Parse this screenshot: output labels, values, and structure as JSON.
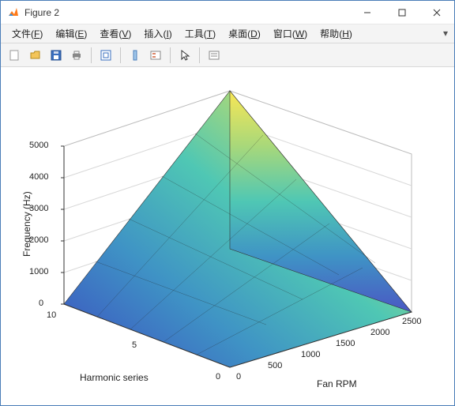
{
  "window": {
    "title": "Figure 2"
  },
  "menubar": {
    "items": [
      {
        "label": "文件",
        "accel": "F"
      },
      {
        "label": "编辑",
        "accel": "E"
      },
      {
        "label": "查看",
        "accel": "V"
      },
      {
        "label": "插入",
        "accel": "I"
      },
      {
        "label": "工具",
        "accel": "T"
      },
      {
        "label": "桌面",
        "accel": "D"
      },
      {
        "label": "窗口",
        "accel": "W"
      },
      {
        "label": "帮助",
        "accel": "H"
      }
    ]
  },
  "toolbar": {
    "icons": {
      "new": "new-figure-icon",
      "open": "open-icon",
      "save": "save-icon",
      "print": "print-icon",
      "edit": "edit-plot-icon",
      "insert": "insert-icon",
      "datacursor": "data-cursor-icon",
      "arrow": "pointer-icon",
      "legend": "legend-icon"
    }
  },
  "chart_data": {
    "type": "surface",
    "title": "",
    "zlabel": "Frequency (Hz)",
    "xlabel": "Fan RPM",
    "ylabel": "Harmonic series",
    "x": {
      "name": "Fan RPM",
      "range": [
        0,
        2500
      ],
      "ticks": [
        0,
        500,
        1000,
        1500,
        2000,
        2500
      ]
    },
    "y": {
      "name": "Harmonic series",
      "range": [
        0,
        10
      ],
      "ticks": [
        0,
        5,
        10
      ]
    },
    "z": {
      "name": "Frequency (Hz)",
      "range": [
        0,
        5000
      ],
      "ticks": [
        0,
        1000,
        2000,
        3000,
        4000,
        5000
      ]
    },
    "formula": "z = (x / 60) * y * 12",
    "corner_values": {
      "x0_y0": 0,
      "x2500_y0": 0,
      "x0_y10": 0,
      "x2500_y10": 5000
    },
    "colormap": "parula",
    "grid": true
  }
}
